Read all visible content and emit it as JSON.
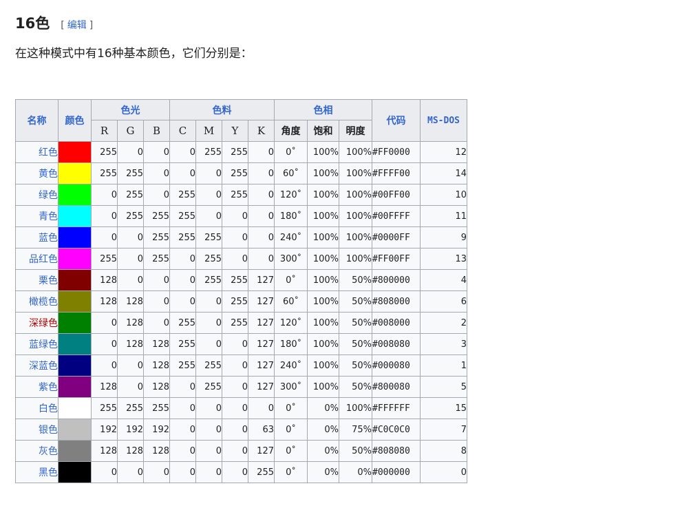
{
  "section": {
    "title": "16色",
    "edit_open": "[",
    "edit_label": "编辑",
    "edit_close": "]",
    "intro": "在这种模式中有16种基本颜色，它们分别是："
  },
  "table": {
    "headers": {
      "name": "名称",
      "color": "颜色",
      "rgb_group": "色光",
      "cmyk_group": "色料",
      "hsl_group": "色相",
      "code": "代码",
      "msdos": "MS-DOS",
      "r": "R",
      "g": "G",
      "b": "B",
      "c": "C",
      "m": "M",
      "y": "Y",
      "k": "K",
      "hue": "角度",
      "sat": "饱和",
      "light": "明度"
    },
    "rows": [
      {
        "name": "红色",
        "swatch": "#FF0000",
        "r": "255",
        "g": "0",
        "b": "0",
        "c": "0",
        "m": "255",
        "y": "255",
        "k": "0",
        "hue": "0˚",
        "sat": "100%",
        "light": "100%",
        "hex": "#FF0000",
        "dos": "12",
        "link": "blue"
      },
      {
        "name": "黄色",
        "swatch": "#FFFF00",
        "r": "255",
        "g": "255",
        "b": "0",
        "c": "0",
        "m": "0",
        "y": "255",
        "k": "0",
        "hue": "60˚",
        "sat": "100%",
        "light": "100%",
        "hex": "#FFFF00",
        "dos": "14",
        "link": "blue"
      },
      {
        "name": "绿色",
        "swatch": "#00FF00",
        "r": "0",
        "g": "255",
        "b": "0",
        "c": "255",
        "m": "0",
        "y": "255",
        "k": "0",
        "hue": "120˚",
        "sat": "100%",
        "light": "100%",
        "hex": "#00FF00",
        "dos": "10",
        "link": "blue"
      },
      {
        "name": "青色",
        "swatch": "#00FFFF",
        "r": "0",
        "g": "255",
        "b": "255",
        "c": "255",
        "m": "0",
        "y": "0",
        "k": "0",
        "hue": "180˚",
        "sat": "100%",
        "light": "100%",
        "hex": "#00FFFF",
        "dos": "11",
        "link": "blue"
      },
      {
        "name": "蓝色",
        "swatch": "#0000FF",
        "r": "0",
        "g": "0",
        "b": "255",
        "c": "255",
        "m": "255",
        "y": "0",
        "k": "0",
        "hue": "240˚",
        "sat": "100%",
        "light": "100%",
        "hex": "#0000FF",
        "dos": "9",
        "link": "blue"
      },
      {
        "name": "品红色",
        "swatch": "#FF00FF",
        "r": "255",
        "g": "0",
        "b": "255",
        "c": "0",
        "m": "255",
        "y": "0",
        "k": "0",
        "hue": "300˚",
        "sat": "100%",
        "light": "100%",
        "hex": "#FF00FF",
        "dos": "13",
        "link": "blue"
      },
      {
        "name": "栗色",
        "swatch": "#800000",
        "r": "128",
        "g": "0",
        "b": "0",
        "c": "0",
        "m": "255",
        "y": "255",
        "k": "127",
        "hue": "0˚",
        "sat": "100%",
        "light": "50%",
        "hex": "#800000",
        "dos": "4",
        "link": "blue"
      },
      {
        "name": "橄榄色",
        "swatch": "#808000",
        "r": "128",
        "g": "128",
        "b": "0",
        "c": "0",
        "m": "0",
        "y": "255",
        "k": "127",
        "hue": "60˚",
        "sat": "100%",
        "light": "50%",
        "hex": "#808000",
        "dos": "6",
        "link": "blue"
      },
      {
        "name": "深绿色",
        "swatch": "#008000",
        "r": "0",
        "g": "128",
        "b": "0",
        "c": "255",
        "m": "0",
        "y": "255",
        "k": "127",
        "hue": "120˚",
        "sat": "100%",
        "light": "50%",
        "hex": "#008000",
        "dos": "2",
        "link": "red"
      },
      {
        "name": "蓝绿色",
        "swatch": "#008080",
        "r": "0",
        "g": "128",
        "b": "128",
        "c": "255",
        "m": "0",
        "y": "0",
        "k": "127",
        "hue": "180˚",
        "sat": "100%",
        "light": "50%",
        "hex": "#008080",
        "dos": "3",
        "link": "blue"
      },
      {
        "name": "深蓝色",
        "swatch": "#000080",
        "r": "0",
        "g": "0",
        "b": "128",
        "c": "255",
        "m": "255",
        "y": "0",
        "k": "127",
        "hue": "240˚",
        "sat": "100%",
        "light": "50%",
        "hex": "#000080",
        "dos": "1",
        "link": "blue"
      },
      {
        "name": "紫色",
        "swatch": "#800080",
        "r": "128",
        "g": "0",
        "b": "128",
        "c": "0",
        "m": "255",
        "y": "0",
        "k": "127",
        "hue": "300˚",
        "sat": "100%",
        "light": "50%",
        "hex": "#800080",
        "dos": "5",
        "link": "blue"
      },
      {
        "name": "白色",
        "swatch": "#FFFFFF",
        "r": "255",
        "g": "255",
        "b": "255",
        "c": "0",
        "m": "0",
        "y": "0",
        "k": "0",
        "hue": "0˚",
        "sat": "0%",
        "light": "100%",
        "hex": "#FFFFFF",
        "dos": "15",
        "link": "blue"
      },
      {
        "name": "银色",
        "swatch": "#C0C0C0",
        "r": "192",
        "g": "192",
        "b": "192",
        "c": "0",
        "m": "0",
        "y": "0",
        "k": "63",
        "hue": "0˚",
        "sat": "0%",
        "light": "75%",
        "hex": "#C0C0C0",
        "dos": "7",
        "link": "blue"
      },
      {
        "name": "灰色",
        "swatch": "#808080",
        "r": "128",
        "g": "128",
        "b": "128",
        "c": "0",
        "m": "0",
        "y": "0",
        "k": "127",
        "hue": "0˚",
        "sat": "0%",
        "light": "50%",
        "hex": "#808080",
        "dos": "8",
        "link": "blue"
      },
      {
        "name": "黑色",
        "swatch": "#000000",
        "r": "0",
        "g": "0",
        "b": "0",
        "c": "0",
        "m": "0",
        "y": "0",
        "k": "255",
        "hue": "0˚",
        "sat": "0%",
        "light": "0%",
        "hex": "#000000",
        "dos": "0",
        "link": "blue"
      }
    ]
  }
}
